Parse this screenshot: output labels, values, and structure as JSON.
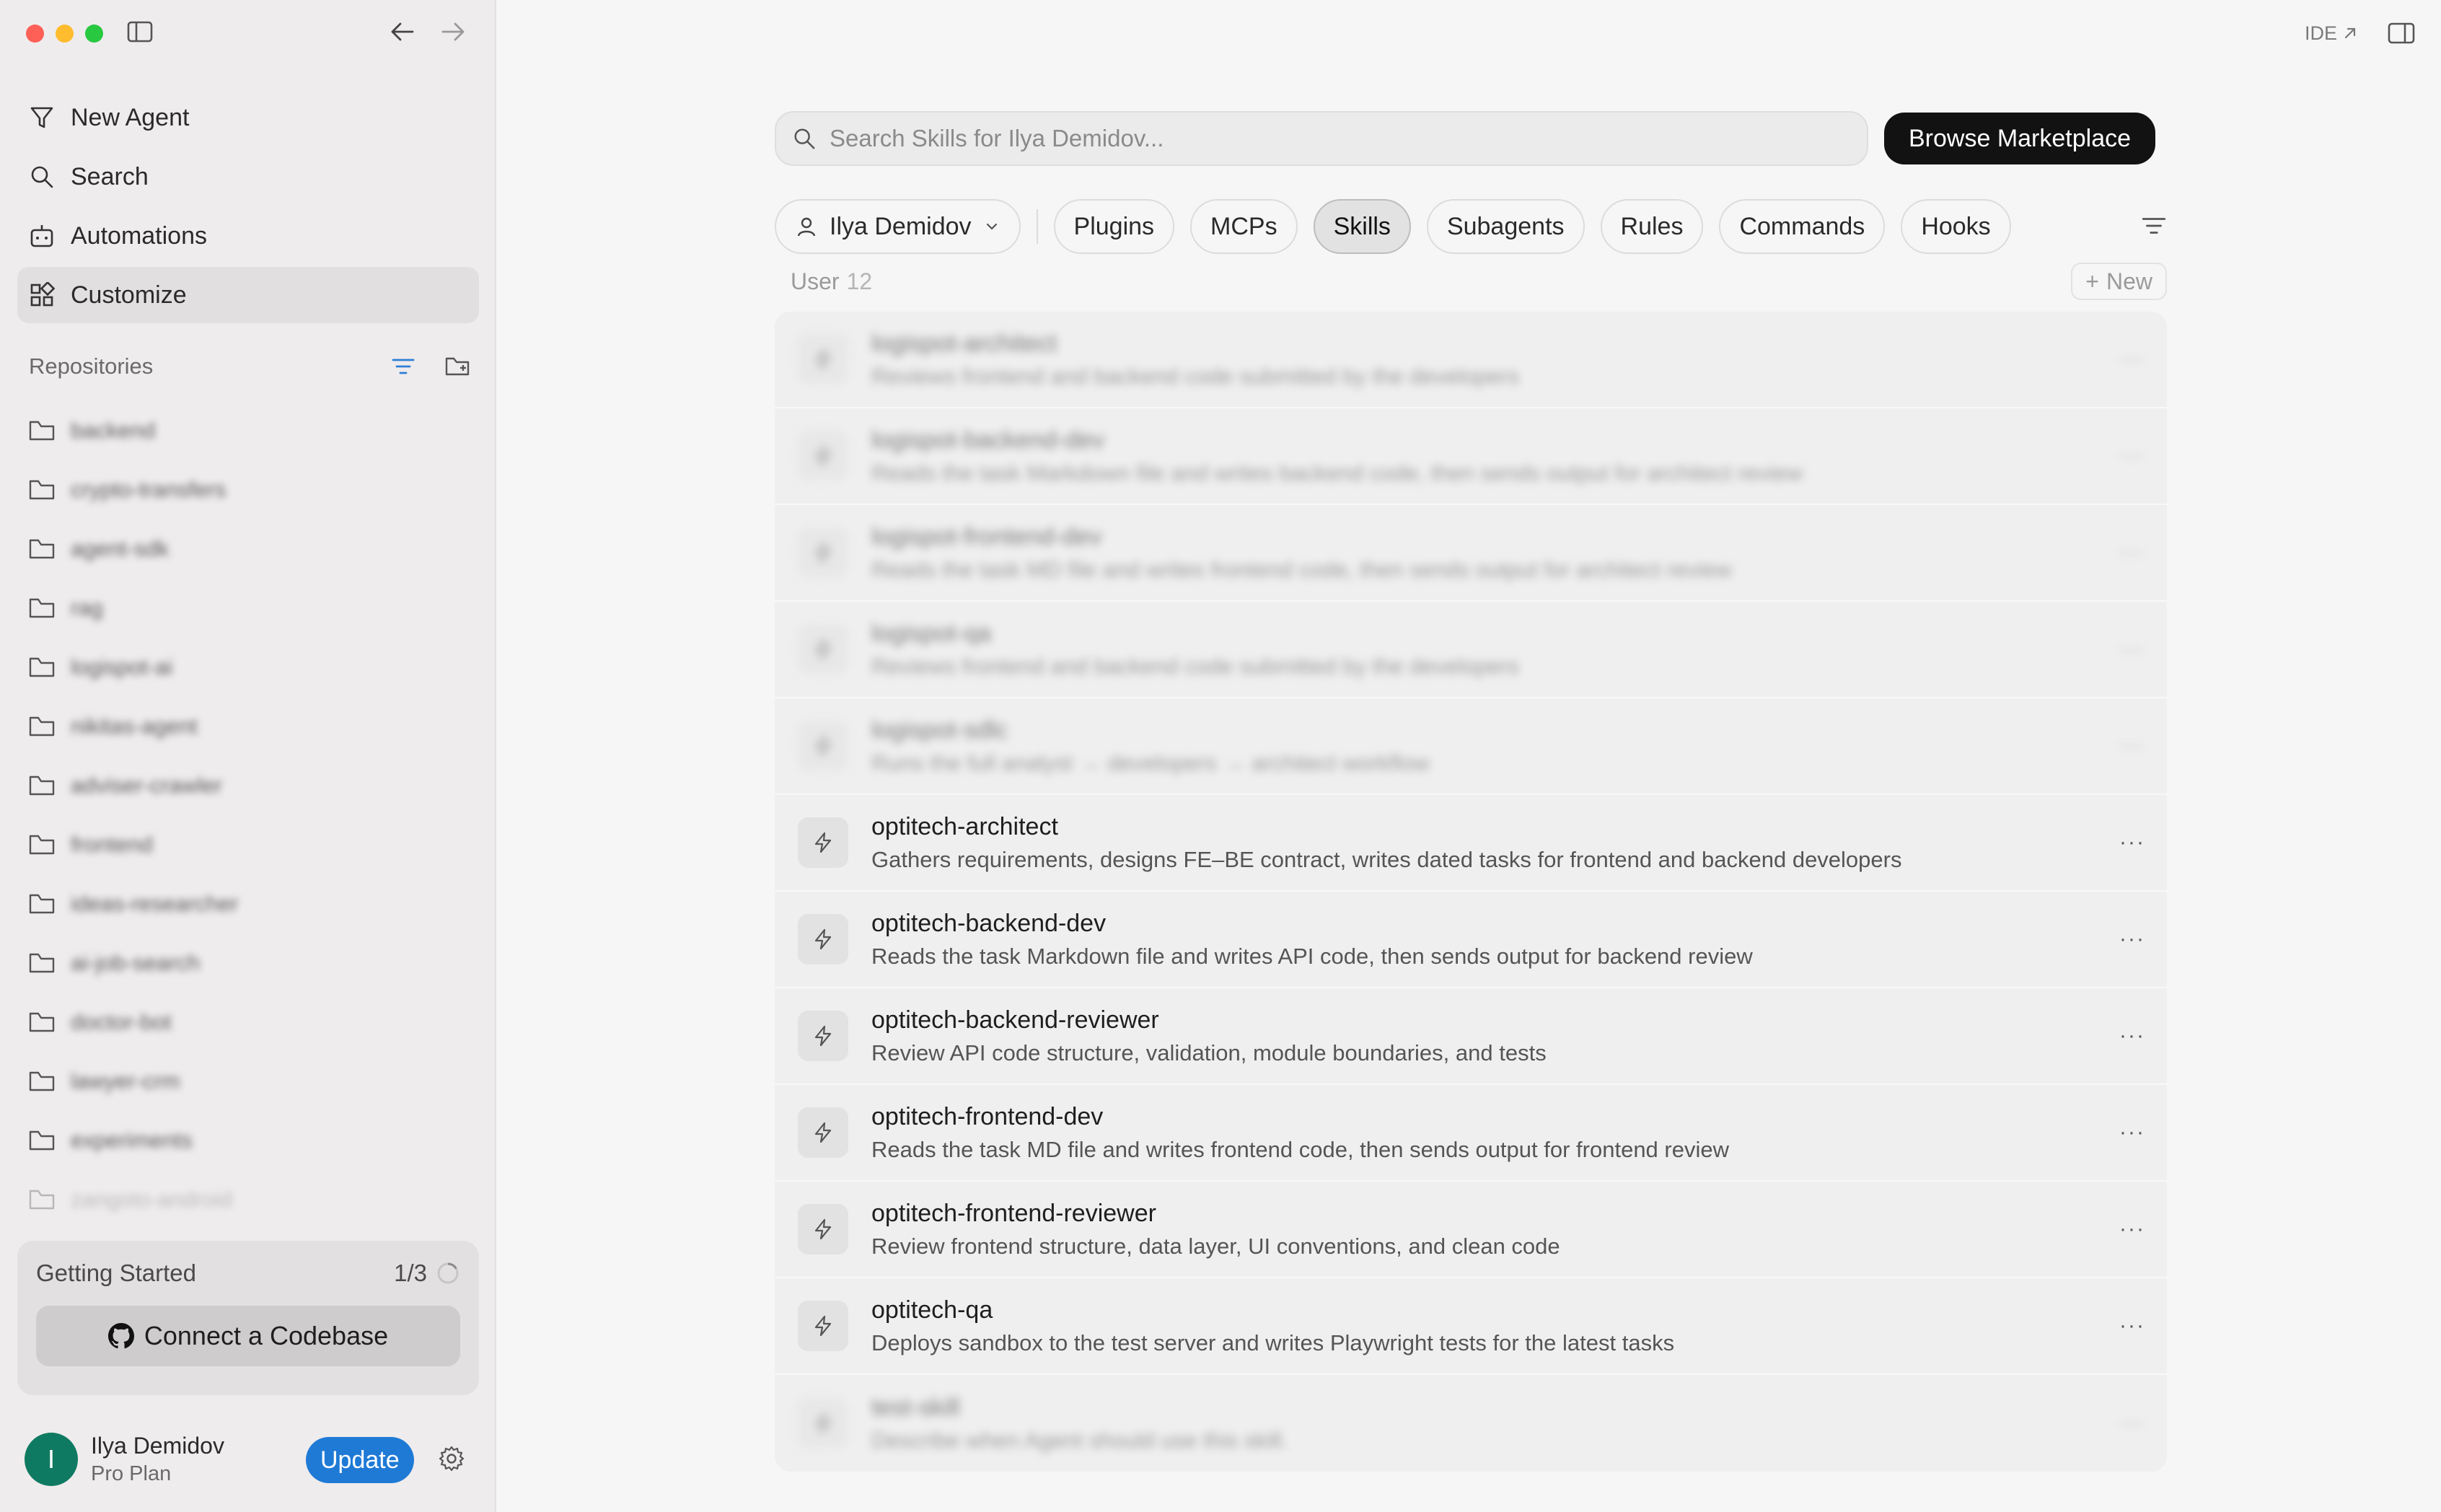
{
  "window": {
    "traffic_colors": [
      "#fe5f57",
      "#febc2e",
      "#28c840"
    ]
  },
  "sidebar": {
    "nav": [
      {
        "label": "New Agent",
        "icon": "funnel-agent-icon"
      },
      {
        "label": "Search",
        "icon": "search-icon"
      },
      {
        "label": "Automations",
        "icon": "automation-icon"
      },
      {
        "label": "Customize",
        "icon": "customize-icon",
        "active": true
      }
    ],
    "repositories_label": "Repositories",
    "repos": [
      {
        "name": "backend"
      },
      {
        "name": "crypto-transfers"
      },
      {
        "name": "agent-sdk"
      },
      {
        "name": "rag"
      },
      {
        "name": "logispot-ai"
      },
      {
        "name": "nikitas-agent"
      },
      {
        "name": "adviser-crawler"
      },
      {
        "name": "frontend"
      },
      {
        "name": "ideas-researcher"
      },
      {
        "name": "ai-job-search"
      },
      {
        "name": "doctor-bot"
      },
      {
        "name": "lawyer-crm"
      },
      {
        "name": "experiments"
      },
      {
        "name": "zangoto-android"
      }
    ],
    "getting_started": {
      "label": "Getting Started",
      "progress": "1/3",
      "connect_label": "Connect a Codebase"
    },
    "user": {
      "initial": "I",
      "name": "Ilya Demidov",
      "plan": "Pro Plan",
      "update_label": "Update",
      "avatar_color": "#0f7a62"
    }
  },
  "header": {
    "ide_label": "IDE"
  },
  "main": {
    "search_placeholder": "Search Skills for Ilya Demidov...",
    "marketplace_label": "Browse  Marketplace",
    "user_select": "Ilya Demidov",
    "tabs": [
      {
        "label": "Plugins"
      },
      {
        "label": "MCPs"
      },
      {
        "label": "Skills",
        "active": true
      },
      {
        "label": "Subagents"
      },
      {
        "label": "Rules"
      },
      {
        "label": "Commands"
      },
      {
        "label": "Hooks"
      }
    ],
    "section_label": "User",
    "section_count": "12",
    "new_label": "New",
    "skills": [
      {
        "name": "logispot-architect",
        "desc": "Reviews frontend and backend code submitted by the developers",
        "blurred": true
      },
      {
        "name": "logispot-backend-dev",
        "desc": "Reads the task Markdown file and writes backend code, then sends output for architect review",
        "blurred": true
      },
      {
        "name": "logispot-frontend-dev",
        "desc": "Reads the task MD file and writes frontend code, then sends output for architect review",
        "blurred": true
      },
      {
        "name": "logispot-qa",
        "desc": "Reviews frontend and backend code submitted by the developers",
        "blurred": true
      },
      {
        "name": "logispot-sdlc",
        "desc": "Runs the full analyst → developers → architect workflow",
        "blurred": true
      },
      {
        "name": "optitech-architect",
        "desc": "Gathers requirements, designs FE–BE contract, writes dated tasks for frontend and backend developers",
        "blurred": false
      },
      {
        "name": "optitech-backend-dev",
        "desc": "Reads the task Markdown file and writes API code, then sends output for backend review",
        "blurred": false
      },
      {
        "name": "optitech-backend-reviewer",
        "desc": "Review API code structure, validation, module boundaries, and tests",
        "blurred": false
      },
      {
        "name": "optitech-frontend-dev",
        "desc": "Reads the task MD file and writes frontend code, then sends output for frontend review",
        "blurred": false
      },
      {
        "name": "optitech-frontend-reviewer",
        "desc": "Review frontend structure, data layer, UI conventions, and clean code",
        "blurred": false
      },
      {
        "name": "optitech-qa",
        "desc": "Deploys sandbox to the test server and writes Playwright tests for the latest tasks",
        "blurred": false
      },
      {
        "name": "test-skill",
        "desc": "Describe when Agent should use this skill.",
        "blurred": true
      }
    ],
    "more_label": "···"
  }
}
